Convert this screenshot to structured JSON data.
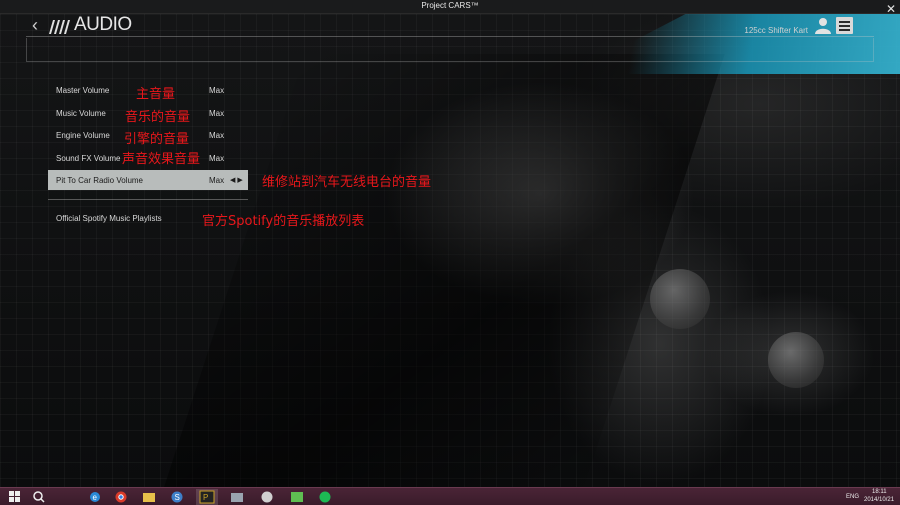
{
  "window": {
    "title": "Project CARS™"
  },
  "header": {
    "title": "AUDIO",
    "profile": "125cc Shifter Kart"
  },
  "settings": [
    {
      "label": "Master Volume",
      "value": "Max"
    },
    {
      "label": "Music Volume",
      "value": "Max"
    },
    {
      "label": "Engine Volume",
      "value": "Max"
    },
    {
      "label": "Sound FX Volume",
      "value": "Max"
    },
    {
      "label": "Pit To Car Radio Volume",
      "value": "Max",
      "selected": true
    }
  ],
  "playlist": {
    "label": "Official Spotify Music Playlists"
  },
  "annotations": {
    "master": "主音量",
    "music": "音乐的音量",
    "engine": "引擎的音量",
    "sfx": "声音效果音量",
    "radio": "维修站到汽车无线电台的音量",
    "spotify": "官方Spotify的音乐播放列表",
    "color": "#e8171b"
  },
  "taskbar": {
    "tray_lang": "ENG",
    "time": "18:11",
    "date": "2014/10/21"
  },
  "colors": {
    "accent_cyan": "#1990b0",
    "selected_row": "#b8bcbb",
    "taskbar": "#4a2436"
  }
}
